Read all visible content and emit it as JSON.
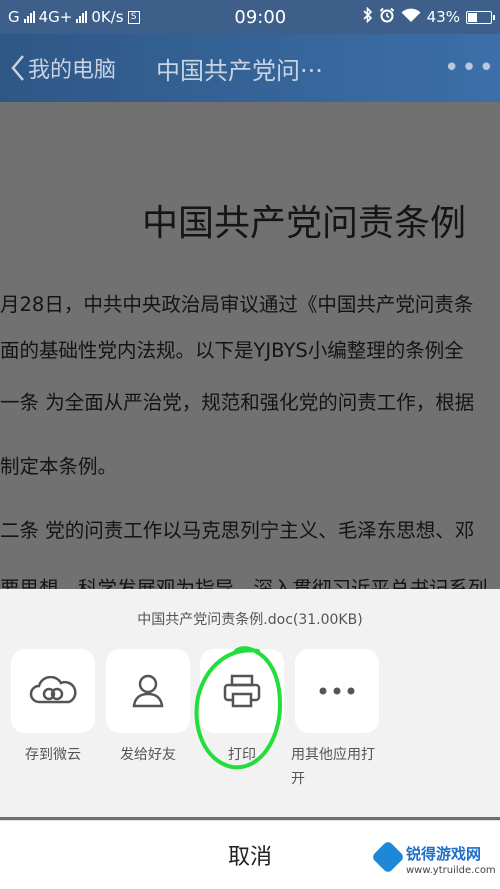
{
  "status_bar": {
    "carrier": "G",
    "network": "4G+",
    "speed": "0K/s",
    "sim_badge": "S",
    "time": "09:00",
    "battery": "43%",
    "battery_level": 0.43
  },
  "nav": {
    "back_label": "我的电脑",
    "title": "中国共产党问···",
    "more_label": "•••"
  },
  "document": {
    "title": "中国共产党问责条例",
    "lines": [
      "月28日，中共中央政治局审议通过《中国共产党问责条",
      "面的基础性党内法规。以下是YJBYS小编整理的条例全",
      "一条  为全面从严治党，规范和强化党的问责工作，根据",
      "制定本条例。",
      "二条  党的问责工作以马克思列宁主义、毛泽东思想、邓",
      "要思想、科学发展观为指导，深入贯彻习近平总书记系列"
    ]
  },
  "share_sheet": {
    "file_name": "中国共产党问责条例.doc(31.00KB)",
    "actions": [
      {
        "label": "存到微云",
        "icon": "cloud-icon"
      },
      {
        "label": "发给好友",
        "icon": "person-icon"
      },
      {
        "label": "打印",
        "icon": "printer-icon"
      },
      {
        "label": "用其他应用打开",
        "icon": "more-dots-icon"
      }
    ],
    "annotation_color": "#22dd3a"
  },
  "cancel": {
    "label": "取消"
  },
  "watermark": {
    "title": "锐得游戏网",
    "url": "www.ytruilde.com"
  }
}
